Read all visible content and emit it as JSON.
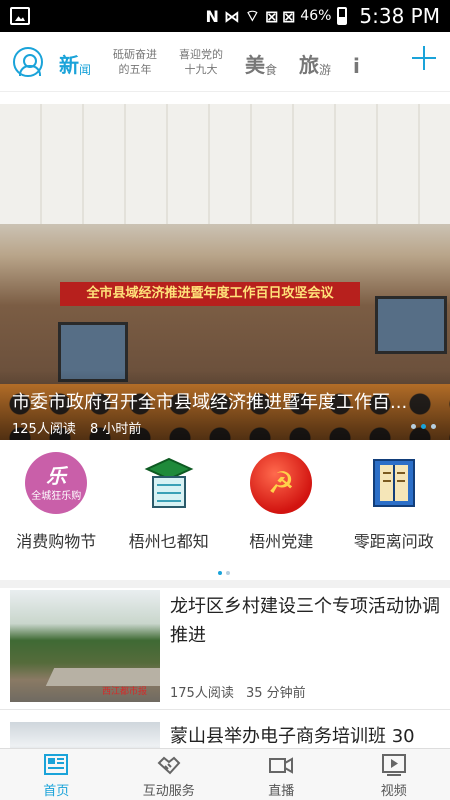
{
  "status_bar": {
    "battery": "46%",
    "time": "5:38 PM",
    "network_glyph": "N",
    "signal_labels": "⊠ ⊠"
  },
  "channels": {
    "active": "新闻",
    "tabs": [
      {
        "big": "新",
        "small": "闻",
        "active": true
      },
      {
        "line1": "砥砺奋进",
        "line2": "的五年"
      },
      {
        "line1": "喜迎党的",
        "line2": "十九大"
      },
      {
        "big": "美",
        "small": "食"
      },
      {
        "big": "旅",
        "small": "游"
      },
      {
        "big": "i",
        "small": ""
      }
    ]
  },
  "hero": {
    "banner_text": "全市县域经济推进暨年度工作百日攻坚会议",
    "headline": "市委市政府召开全市县域经济推进暨年度工作百...",
    "reads": "125人阅读",
    "time": "8 小时前",
    "page_count": 3,
    "active_page": 2
  },
  "quick_entries": [
    {
      "label": "消费购物节",
      "icon": "shopping-festival-icon",
      "icon_text": "乐",
      "icon_sub": "全城狂乐购"
    },
    {
      "label": "梧州乜都知",
      "icon": "graduation-cap-icon"
    },
    {
      "label": "梧州党建",
      "icon": "party-emblem-icon",
      "icon_text": "☭"
    },
    {
      "label": "零距离问政",
      "icon": "book-icon"
    }
  ],
  "news": [
    {
      "title": "龙圩区乡村建设三个专项活动协调推进",
      "reads": "175人阅读",
      "time": "35 分钟前",
      "thumb_tag": "西江都市报"
    },
    {
      "title": "蒙山县举办电子商务培训班 30"
    }
  ],
  "bottom_nav": [
    {
      "label": "首页",
      "icon": "newspaper-icon",
      "active": true
    },
    {
      "label": "互动服务",
      "icon": "handshake-icon"
    },
    {
      "label": "直播",
      "icon": "video-camera-icon"
    },
    {
      "label": "视频",
      "icon": "play-screen-icon"
    }
  ],
  "colors": {
    "accent": "#1aa3d9"
  }
}
